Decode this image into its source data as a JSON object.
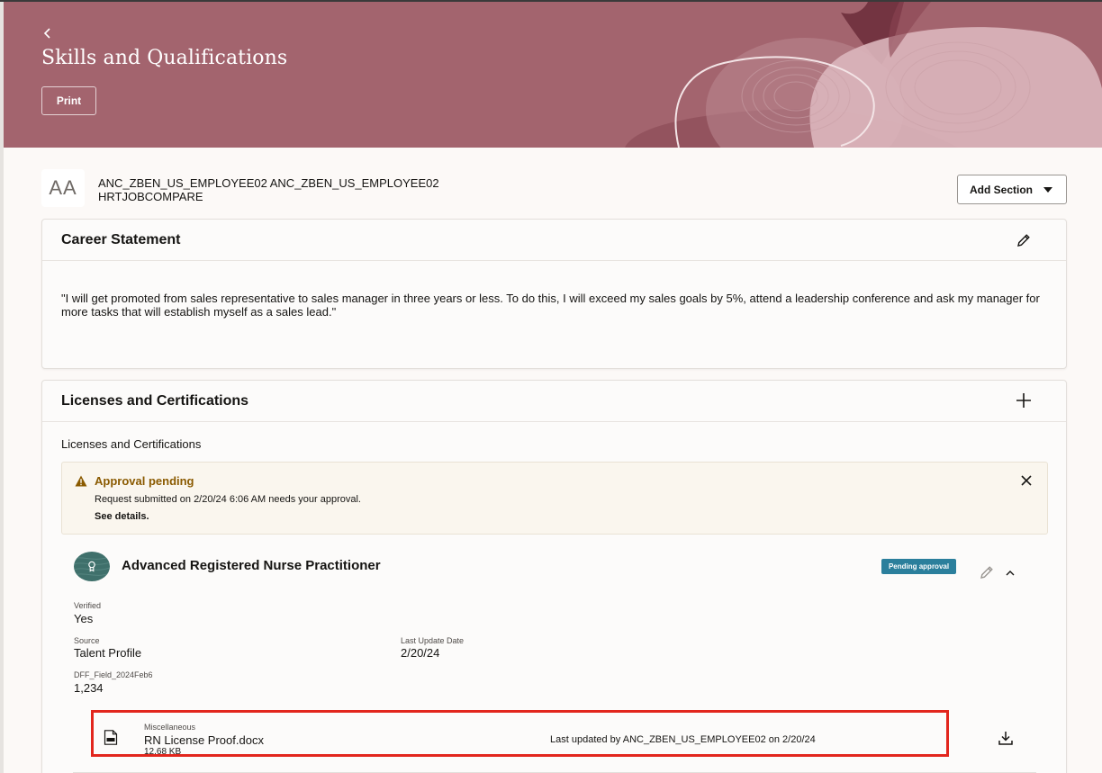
{
  "header": {
    "back_label": "<",
    "title": "Skills and Qualifications",
    "print_label": "Print"
  },
  "person": {
    "initials": "AA",
    "name": "ANC_ZBEN_US_EMPLOYEE02 ANC_ZBEN_US_EMPLOYEE02",
    "subtitle": "HRTJOBCOMPARE"
  },
  "add_section_label": "Add Section",
  "career_statement": {
    "title": "Career Statement",
    "text": "\"I will get promoted from sales representative to sales manager in three years or less. To do this, I will exceed my sales goals by 5%, attend a leadership conference and ask my manager for more tasks that will establish myself as a sales lead.\""
  },
  "licenses": {
    "title": "Licenses and Certifications",
    "sub_heading": "Licenses and Certifications",
    "approval": {
      "title": "Approval pending",
      "message": "Request submitted on 2/20/24 6:06 AM needs your approval.",
      "link": "See details."
    },
    "item": {
      "name": "Advanced Registered Nurse Practitioner",
      "status_badge": "Pending approval",
      "fields": {
        "verified_label": "Verified",
        "verified_value": "Yes",
        "source_label": "Source",
        "source_value": "Talent Profile",
        "last_update_label": "Last Update Date",
        "last_update_value": "2/20/24",
        "dff_label": "DFF_Field_2024Feb6",
        "dff_value": "1,234"
      },
      "attachment": {
        "category": "Miscellaneous",
        "file_name": "RN License Proof.docx",
        "file_size": "12.68 KB",
        "updated_text": "Last updated by ANC_ZBEN_US_EMPLOYEE02 on 2/20/24"
      }
    }
  },
  "colors": {
    "banner": "#a3646e",
    "warning_text": "#8a5a00",
    "badge": "#2b7f9c",
    "highlight_box": "#e2261d"
  }
}
